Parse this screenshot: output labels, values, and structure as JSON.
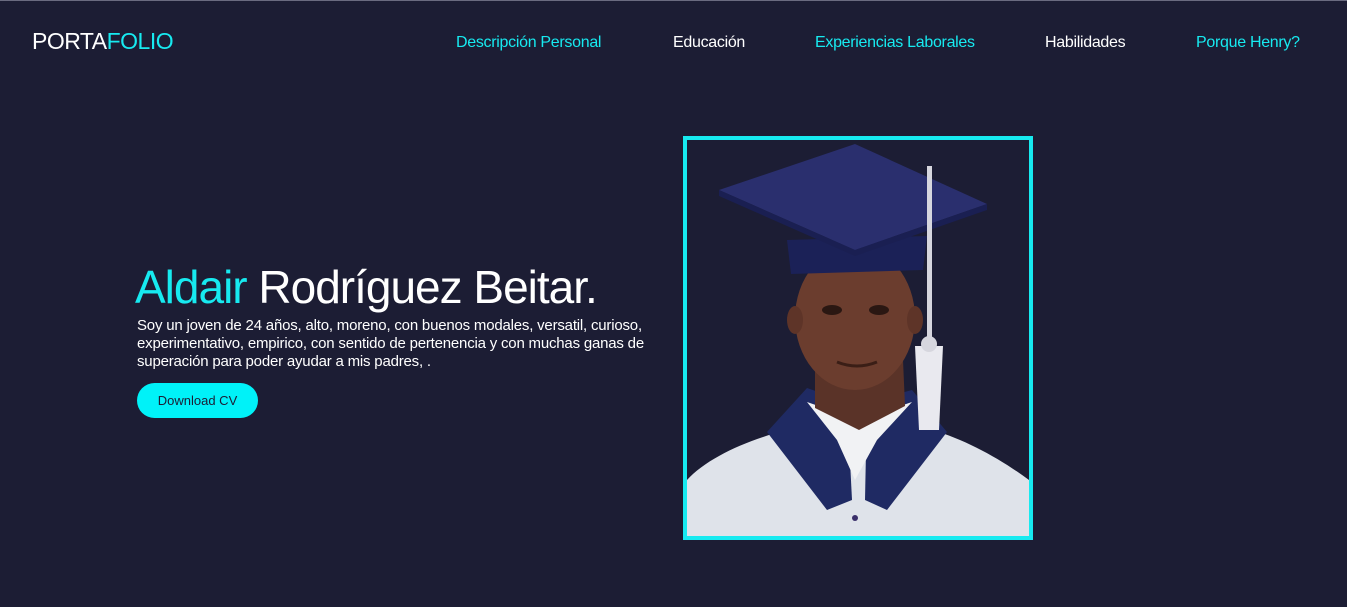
{
  "header": {
    "logo_part1": "PORTA",
    "logo_part2": "FOLIO",
    "nav": [
      {
        "label": "Descripción Personal",
        "color": "#17eaf0"
      },
      {
        "label": "Educación",
        "color": "#ffffff"
      },
      {
        "label": "Experiencias Laborales",
        "color": "#17eaf0"
      },
      {
        "label": "Habilidades",
        "color": "#ffffff"
      },
      {
        "label": "Porque Henry?",
        "color": "#17eaf0"
      }
    ]
  },
  "hero": {
    "first_name": "Aldair",
    "last_name": " Rodríguez Beitar.",
    "description": "Soy un joven de 24 años, alto, moreno, con buenos modales, versatil, curioso, experimentativo, empirico, con sentido de pertenencia y con muchas ganas de superación para poder ayudar a mis padres, .",
    "download_label": "Download CV"
  },
  "colors": {
    "background": "#1c1d34",
    "accent": "#17eaf0",
    "button": "#00f2f8"
  }
}
